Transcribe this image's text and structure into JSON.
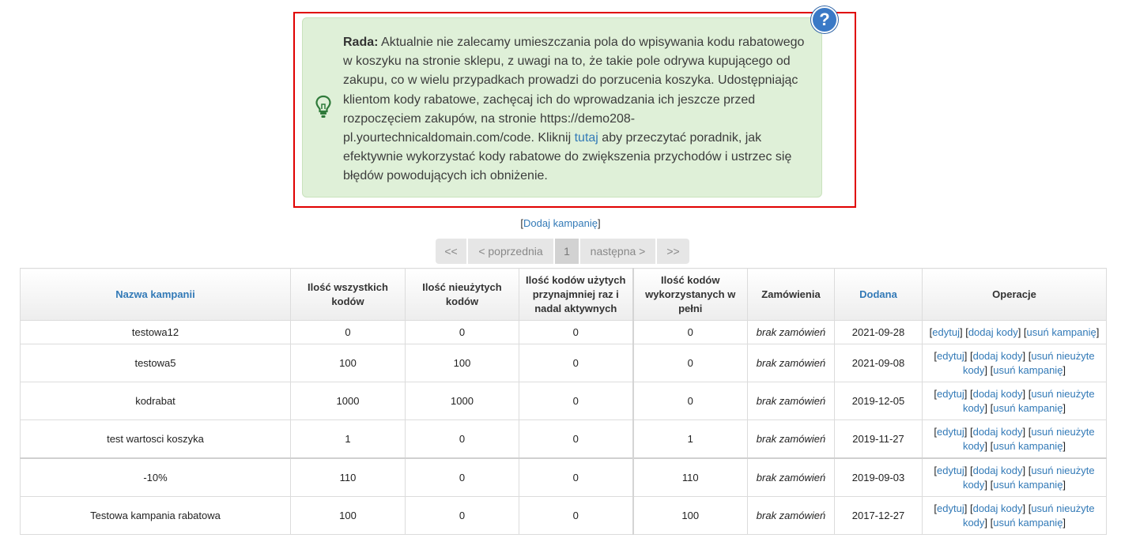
{
  "tip": {
    "title": "Rada:",
    "text_before_link": " Aktualnie nie zalecamy umieszczania pola do wpisywania kodu rabatowego w koszyku na stronie sklepu, z uwagi na to, że takie pole odrywa kupującego od zakupu, co w wielu przypadkach prowadzi do porzucenia koszyka. Udostępniając klientom kody rabatowe, zachęcaj ich do wprowadzania ich jeszcze przed rozpoczęciem zakupów, na stronie https://demo208-pl.yourtechnicaldomain.com/code. Kliknij ",
    "link_label": "tutaj",
    "text_after_link": " aby przeczytać poradnik, jak efektywnie wykorzystać kody rabatowe do zwiększenia przychodów i ustrzec się błędów powodujących ich obniżenie.",
    "help_icon_glyph": "?"
  },
  "actions": {
    "add_campaign_prefix": "[",
    "add_campaign_label": "Dodaj kampanię",
    "add_campaign_suffix": "]"
  },
  "pagination": {
    "first": "<<",
    "prev": "< poprzednia",
    "current": "1",
    "next": "następna >",
    "last": ">>"
  },
  "table": {
    "headers": {
      "name": "Nazwa kampanii",
      "all_codes": "Ilość wszystkich kodów",
      "unused_codes": "Ilość nieużytych kodów",
      "used_active": "Ilość kodów użytych przynajmniej raz i nadal aktywnych",
      "fully_used": "Ilość kodów wykorzystanych w pełni",
      "orders": "Zamówienia",
      "added": "Dodana",
      "operations": "Operacje"
    },
    "ops": {
      "edit": "edytuj",
      "add_codes": "dodaj kody",
      "remove_unused": "usuń nieużyte kody",
      "remove_campaign": "usuń kampanię"
    },
    "rows": [
      {
        "name": "testowa12",
        "all": "0",
        "unused": "0",
        "used_active": "0",
        "fully_used": "0",
        "orders": "brak zamówień",
        "added": "2021-09-28"
      },
      {
        "name": "testowa5",
        "all": "100",
        "unused": "100",
        "used_active": "0",
        "fully_used": "0",
        "orders": "brak zamówień",
        "added": "2021-09-08"
      },
      {
        "name": "kodrabat",
        "all": "1000",
        "unused": "1000",
        "used_active": "0",
        "fully_used": "0",
        "orders": "brak zamówień",
        "added": "2019-12-05"
      },
      {
        "name": "test wartosci koszyka",
        "all": "1",
        "unused": "0",
        "used_active": "0",
        "fully_used": "1",
        "orders": "brak zamówień",
        "added": "2019-11-27"
      },
      {
        "name": "-10%",
        "all": "110",
        "unused": "0",
        "used_active": "0",
        "fully_used": "110",
        "orders": "brak zamówień",
        "added": "2019-09-03"
      },
      {
        "name": "Testowa kampania rabatowa",
        "all": "100",
        "unused": "0",
        "used_active": "0",
        "fully_used": "100",
        "orders": "brak zamówień",
        "added": "2017-12-27"
      }
    ]
  },
  "colors": {
    "tip_background": "#dff0d8",
    "highlight_border": "#e00000",
    "link": "#337ab7",
    "help_icon": "#3a79c6"
  }
}
